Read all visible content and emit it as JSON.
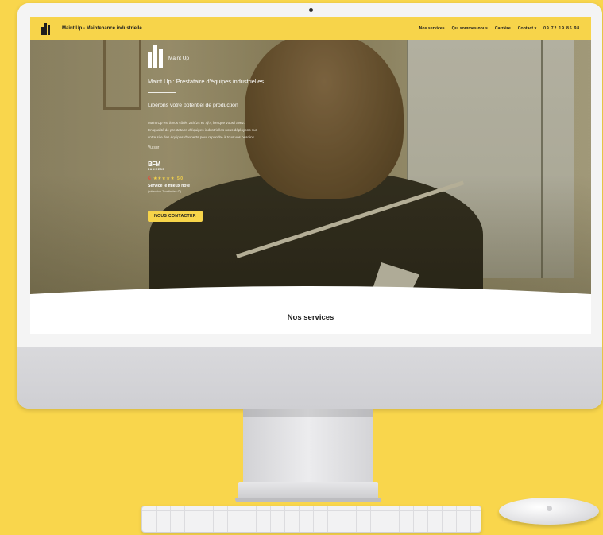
{
  "nav": {
    "site_title": "Maint Up - Maintenance industrielle",
    "menu": {
      "services": "Nos services",
      "about": "Qui sommes-nous",
      "careers": "Carrière",
      "contact": "Contact",
      "phone": "09 72 19 86 98"
    }
  },
  "hero": {
    "brand_name": "Maint Up",
    "tagline": "Maint Up : Prestataire d'équipes industrielles",
    "subtitle": "Libérons votre potentiel de production",
    "desc_lines": [
      "Maint Up est à vos côtés 24h/24 et 7j/7, lorsque vous l'avez.",
      "En qualité de prestataire d'équipes industrielles nous déployons sur",
      "votre site des équipes d'experts pour répondre à tous vos besoins."
    ],
    "vu_sur": "Vu sur",
    "bfm": {
      "name": "BFM",
      "sub": "BUSINESS"
    },
    "rating": {
      "g": "G",
      "stars": "★★★★★",
      "score": "5.0"
    },
    "best_label": "Service le mieux noté",
    "best_sub": "(sélection Trustindex ©)",
    "cta": "NOUS CONTACTER"
  },
  "services": {
    "title": "Nos services"
  },
  "colors": {
    "accent": "#f7d44a",
    "background": "#f9d64c",
    "dark": "#1e1e1e"
  }
}
